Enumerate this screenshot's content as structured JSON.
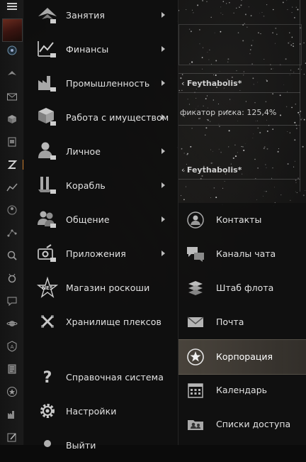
{
  "background": {
    "pilot_name_1": "Feythabolis*",
    "risk_text": "фикатор риска: 125,4%",
    "pilot_name_2": "Feythabolis*"
  },
  "menu": {
    "items": [
      {
        "label": "Занятия",
        "icon": "activities-icon",
        "has_submenu": true
      },
      {
        "label": "Финансы",
        "icon": "finance-chart-icon",
        "has_submenu": true
      },
      {
        "label": "Промышленность",
        "icon": "industry-factory-icon",
        "has_submenu": true
      },
      {
        "label": "Работа с имуществом",
        "icon": "assets-cube-icon",
        "has_submenu": true
      },
      {
        "label": "Личное",
        "icon": "person-icon",
        "has_submenu": true
      },
      {
        "label": "Корабль",
        "icon": "ship-icon",
        "has_submenu": true
      },
      {
        "label": "Общение",
        "icon": "people-icon",
        "has_submenu": true
      },
      {
        "label": "Приложения",
        "icon": "applications-icon",
        "has_submenu": true
      },
      {
        "label": "Магазин роскоши",
        "icon": "nes-store-icon",
        "has_submenu": false
      },
      {
        "label": "Хранилище плексов",
        "icon": "plex-vault-icon",
        "has_submenu": false
      },
      {
        "label": "Справочная система",
        "icon": "help-question-icon",
        "has_submenu": false
      },
      {
        "label": "Настройки",
        "icon": "settings-gear-icon",
        "has_submenu": false
      },
      {
        "label": "Выйти",
        "icon": "logout-icon",
        "has_submenu": false
      }
    ]
  },
  "submenu": {
    "items": [
      {
        "label": "Контакты",
        "icon": "contacts-icon"
      },
      {
        "label": "Каналы чата",
        "icon": "chat-channels-icon"
      },
      {
        "label": "Штаб флота",
        "icon": "fleet-hq-icon"
      },
      {
        "label": "Почта",
        "icon": "mail-icon"
      },
      {
        "label": "Корпорация",
        "icon": "corporation-icon",
        "selected": true
      },
      {
        "label": "Календарь",
        "icon": "calendar-icon"
      },
      {
        "label": "Списки доступа",
        "icon": "access-lists-icon"
      }
    ]
  },
  "sidebar_icons": [
    "hamburger-menu-icon",
    "character-portrait",
    "location-icon",
    "activities-icon",
    "mail-icon",
    "inventory-icon",
    "document-icon",
    "z-icon",
    "wallet-chart-icon",
    "agency-icon",
    "map-icon",
    "search-icon",
    "fitting-icon",
    "chat-icon",
    "planet-icon",
    "shield-icon",
    "notes-icon",
    "star-icon",
    "industry-icon",
    "edit-icon"
  ],
  "colors": {
    "accent": "#c0782c",
    "selected_row": "#6e665a"
  }
}
